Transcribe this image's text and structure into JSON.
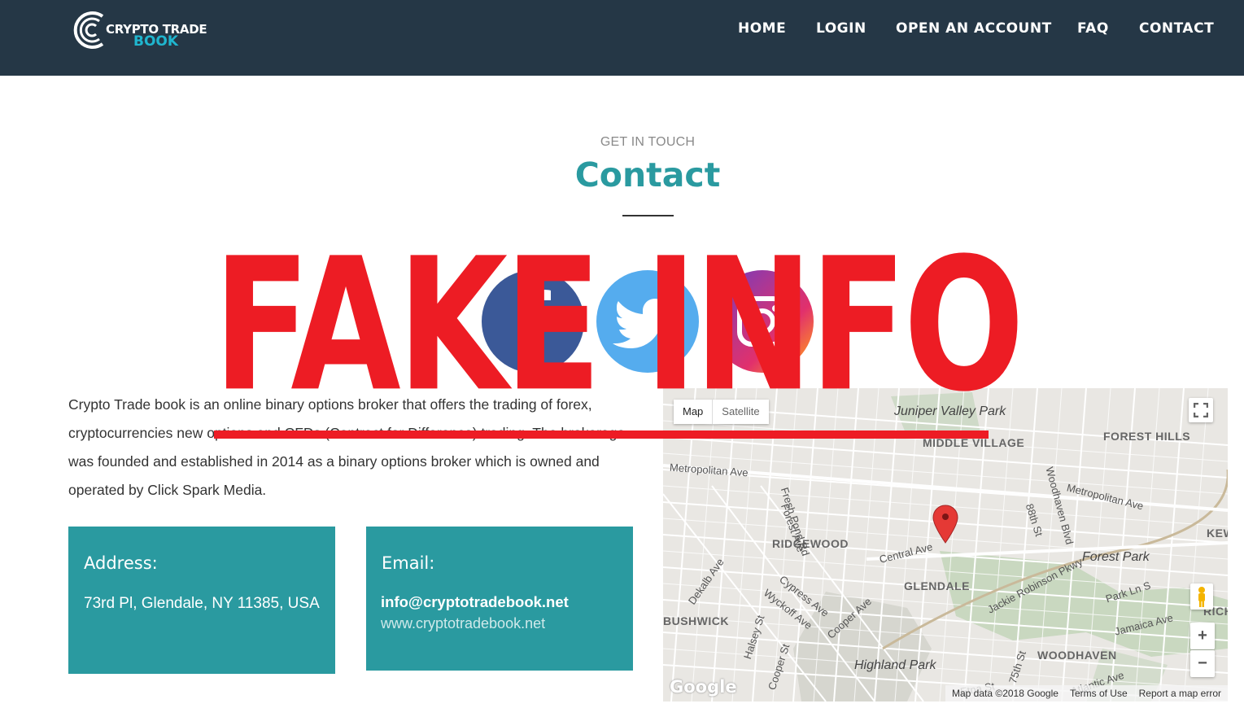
{
  "header": {
    "logo_line1": "CRYPTO TRADE",
    "logo_line2": "BOOK",
    "nav": [
      "HOME",
      "LOGIN",
      "OPEN AN ACCOUNT",
      "FAQ",
      "CONTACT"
    ]
  },
  "section": {
    "eyebrow": "GET IN TOUCH",
    "title": "Contact"
  },
  "social": [
    "facebook-icon",
    "twitter-icon",
    "instagram-icon"
  ],
  "about": "Crypto Trade book is an online binary options broker that offers the trading of forex, cryptocurrencies new options and CFDs (Contract for Difference) trading. The brokerage was founded and established in 2014 as a binary options broker which is owned and operated by Click Spark Media.",
  "address_card": {
    "heading": "Address:",
    "text": "73rd Pl, Glendale, NY 11385, USA"
  },
  "email_card": {
    "heading": "Email:",
    "email": "info@cryptotradebook.net",
    "website": "www.cryptotradebook.net"
  },
  "map": {
    "tab_map": "Map",
    "tab_satellite": "Satellite",
    "neighborhoods": [
      "MIDDLE VILLAGE",
      "FOREST HILLS",
      "RIDGEWOOD",
      "GLENDALE",
      "BUSHWICK",
      "WOODHAVEN",
      "KEW",
      "RICH"
    ],
    "parks": [
      "Juniper Valley Park",
      "Forest Park",
      "Highland Park"
    ],
    "streets": [
      "Metropolitan Ave",
      "Fresh Pond Rd",
      "Forest Ave",
      "Central Ave",
      "Dekalb Ave",
      "Cypress Ave",
      "Wyckoff Ave",
      "Cooper Ave",
      "Halsey St",
      "Cooper St",
      "Woodhaven Blvd",
      "88th St",
      "Jackie Robinson Pkwy",
      "Park Ln S",
      "Jamaica Ave",
      "75th St",
      "Atlantic Ave",
      "Etna St",
      "Metropolitan Ave"
    ],
    "zoom_in": "+",
    "zoom_out": "−",
    "google_mark": "Google",
    "footer": [
      "Map data ©2018 Google",
      "Terms of Use",
      "Report a map error"
    ]
  },
  "overlay": {
    "stamp": "FAKE INFO"
  },
  "colors": {
    "header_bg": "#253746",
    "accent_teal": "#2a9aa0",
    "logo_blue": "#1fb6cf",
    "stamp_red": "#ed1c24"
  }
}
